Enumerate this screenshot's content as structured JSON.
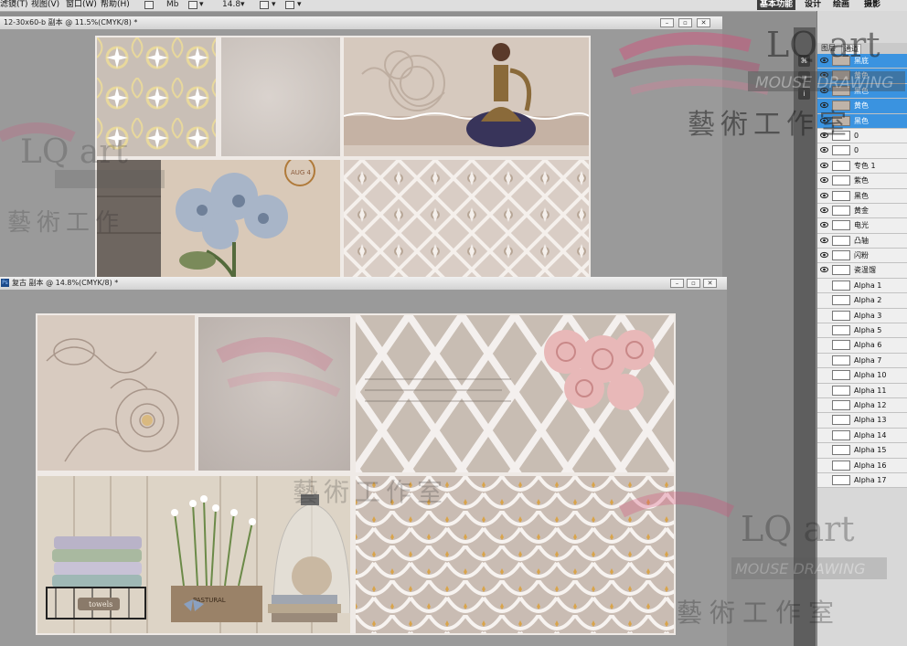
{
  "menubar": {
    "items": [
      "滤镜(T)",
      "视图(V)",
      "窗口(W)",
      "帮助(H)"
    ],
    "mb_label": "Mb",
    "zoom": "14.8",
    "workspaces": [
      "基本功能",
      "设计",
      "绘画",
      "摄影"
    ]
  },
  "window1": {
    "title": "12-30x60-b 副本 @ 11.5%(CMYK/8) *"
  },
  "window2": {
    "badge": "Ps",
    "title": "复古 副本 @ 14.8%(CMYK/8) *"
  },
  "tile_text": {
    "towels": "towels",
    "pastural": "PASTURAL",
    "stamp": "AUG 4"
  },
  "panel": {
    "tabs": [
      "图层",
      "通道"
    ],
    "layers": [
      {
        "name": "黑底",
        "selected": true,
        "eye": true
      },
      {
        "name": "黄色",
        "selected": true,
        "eye": true
      },
      {
        "name": "黑色",
        "selected": true,
        "eye": true
      },
      {
        "name": "黄色",
        "selected": true,
        "eye": true
      },
      {
        "name": "黑色",
        "selected": true,
        "eye": true
      },
      {
        "name": "0",
        "selected": false,
        "eye": true
      },
      {
        "name": "0",
        "selected": false,
        "eye": true
      },
      {
        "name": "专色 1",
        "selected": false,
        "eye": true
      },
      {
        "name": "紫色",
        "selected": false,
        "eye": true
      },
      {
        "name": "黑色",
        "selected": false,
        "eye": true
      },
      {
        "name": "黄金",
        "selected": false,
        "eye": true
      },
      {
        "name": "电光",
        "selected": false,
        "eye": true
      },
      {
        "name": "凸轴",
        "selected": false,
        "eye": true
      },
      {
        "name": "闪粉",
        "selected": false,
        "eye": true
      },
      {
        "name": "瓷温馏",
        "selected": false,
        "eye": true
      },
      {
        "name": "Alpha 1",
        "selected": false,
        "eye": false
      },
      {
        "name": "Alpha 2",
        "selected": false,
        "eye": false
      },
      {
        "name": "Alpha 3",
        "selected": false,
        "eye": false
      },
      {
        "name": "Alpha 5",
        "selected": false,
        "eye": false
      },
      {
        "name": "Alpha 6",
        "selected": false,
        "eye": false
      },
      {
        "name": "Alpha 7",
        "selected": false,
        "eye": false
      },
      {
        "name": "Alpha 10",
        "selected": false,
        "eye": false
      },
      {
        "name": "Alpha 11",
        "selected": false,
        "eye": false
      },
      {
        "name": "Alpha 12",
        "selected": false,
        "eye": false
      },
      {
        "name": "Alpha 13",
        "selected": false,
        "eye": false
      },
      {
        "name": "Alpha 14",
        "selected": false,
        "eye": false
      },
      {
        "name": "Alpha 15",
        "selected": false,
        "eye": false
      },
      {
        "name": "Alpha 16",
        "selected": false,
        "eye": false
      },
      {
        "name": "Alpha 17",
        "selected": false,
        "eye": false
      }
    ]
  },
  "watermark": {
    "brand": "LQ art",
    "tagline": "MOUSE DRAWING",
    "chinese": "藝術工作室"
  },
  "colors": {
    "selected_layer": "#3a93e0",
    "canvas": "#efeae6",
    "brush_pink": "#d8567d"
  }
}
